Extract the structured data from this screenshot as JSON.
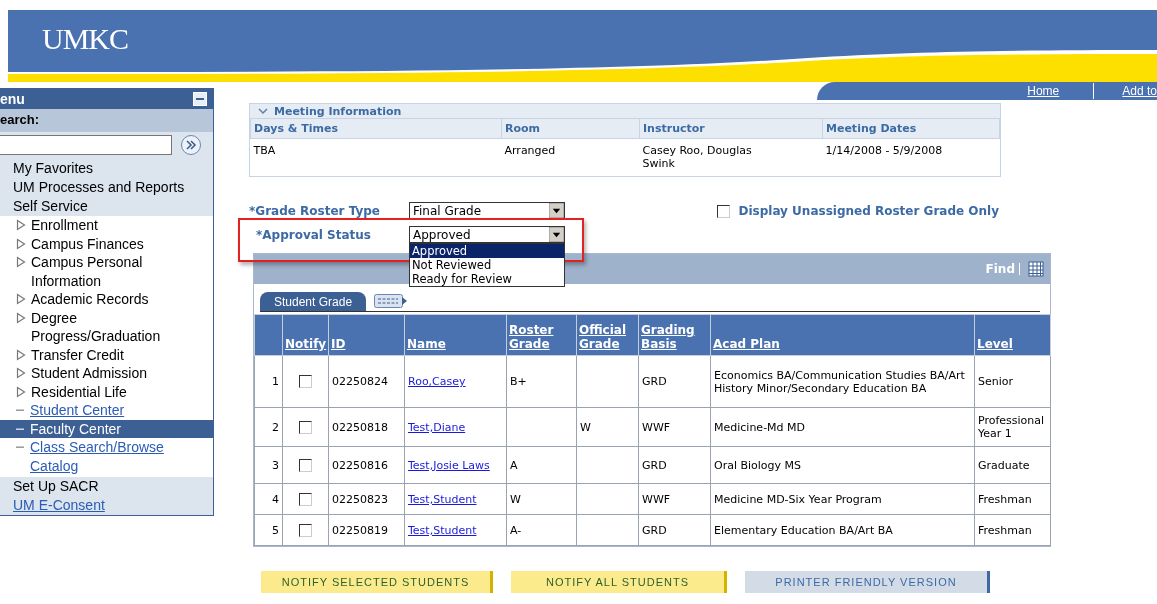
{
  "header": {
    "logo": "UMKC"
  },
  "nav": {
    "links": [
      "Home",
      "Add to"
    ]
  },
  "menu": {
    "title": "enu",
    "search_label": "earch:",
    "items": [
      {
        "label": "My Favorites",
        "kind": "folder",
        "selected": false
      },
      {
        "label": "UM Processes and Reports",
        "kind": "folder",
        "selected": false
      },
      {
        "label": "Self Service",
        "kind": "folder",
        "selected": false,
        "children": [
          {
            "label": "Enrollment",
            "kind": "folder",
            "selected": false
          },
          {
            "label": "Campus Finances",
            "kind": "folder",
            "selected": false
          },
          {
            "label": "Campus Personal Information",
            "kind": "folder",
            "selected": false
          },
          {
            "label": "Academic Records",
            "kind": "folder",
            "selected": false
          },
          {
            "label": "Degree Progress/Graduation",
            "kind": "folder",
            "selected": false
          },
          {
            "label": "Transfer Credit",
            "kind": "folder",
            "selected": false
          },
          {
            "label": "Student Admission",
            "kind": "folder",
            "selected": false
          },
          {
            "label": "Residential Life",
            "kind": "folder",
            "selected": false
          },
          {
            "label": "Student Center",
            "kind": "link",
            "selected": false
          },
          {
            "label": "Faculty Center",
            "kind": "link",
            "selected": true
          },
          {
            "label": "Class Search/Browse Catalog",
            "kind": "link",
            "selected": false
          }
        ]
      },
      {
        "label": "Set Up SACR",
        "kind": "folder",
        "selected": false
      },
      {
        "label": "UM E-Consent",
        "kind": "link",
        "selected": false
      }
    ]
  },
  "meeting": {
    "title": "Meeting Information",
    "columns": [
      "Days & Times",
      "Room",
      "Instructor",
      "Meeting Dates"
    ],
    "rows": [
      [
        "TBA",
        "Arranged",
        "Casey Roo, Douglas Swink",
        "1/14/2008 - 5/9/2008"
      ]
    ]
  },
  "fields": [
    {
      "label": "*Grade Roster Type",
      "value": "Final Grade",
      "highlighted": false
    },
    {
      "label": "*Approval Status",
      "value": "Approved",
      "highlighted": true,
      "options": [
        {
          "label": "Approved",
          "selected": true
        },
        {
          "label": "Not Reviewed",
          "selected": false
        },
        {
          "label": "Ready for Review",
          "selected": false
        }
      ]
    }
  ],
  "checkbox": {
    "label": "Display Unassigned Roster Grade Only",
    "checked": false
  },
  "grid": {
    "find": "Find",
    "tabs": [
      {
        "label": "Student Grade",
        "selected": true
      }
    ],
    "columns": [
      "Notify",
      "ID",
      "Name",
      "Roster Grade",
      "Official Grade",
      "Grading Basis",
      "Acad Plan",
      "Level"
    ],
    "rows": [
      {
        "num": "1",
        "notify": false,
        "id": "02250824",
        "name": "Roo,Casey",
        "roster_grade": "B+",
        "official_grade": "",
        "grading_basis": "GRD",
        "acad_plan": "Economics BA/Communication Studies BA/Art History Minor/Secondary Education BA",
        "level": "Senior"
      },
      {
        "num": "2",
        "notify": false,
        "id": "02250818",
        "name": "Test,Diane",
        "roster_grade": "",
        "official_grade": "W",
        "grading_basis": "WWF",
        "acad_plan": "Medicine-Md MD",
        "level": "Professional Year 1"
      },
      {
        "num": "3",
        "notify": false,
        "id": "02250816",
        "name": "Test,Josie Laws",
        "roster_grade": "A",
        "official_grade": "",
        "grading_basis": "GRD",
        "acad_plan": "Oral Biology MS",
        "level": "Graduate"
      },
      {
        "num": "4",
        "notify": false,
        "id": "02250823",
        "name": "Test,Student",
        "roster_grade": "W",
        "official_grade": "",
        "grading_basis": "WWF",
        "acad_plan": "Medicine MD-Six Year Program",
        "level": "Freshman"
      },
      {
        "num": "5",
        "notify": false,
        "id": "02250819",
        "name": "Test,Student",
        "roster_grade": "A-",
        "official_grade": "",
        "grading_basis": "GRD",
        "acad_plan": "Elementary Education BA/Art BA",
        "level": "Freshman"
      }
    ]
  },
  "buttons": [
    {
      "label": "NOTIFY SELECTED STUDENTS",
      "kind": "primary"
    },
    {
      "label": "NOTIFY ALL STUDENTS",
      "kind": "primary"
    },
    {
      "label": "PRINTER FRIENDLY VERSION",
      "kind": "secondary"
    }
  ]
}
